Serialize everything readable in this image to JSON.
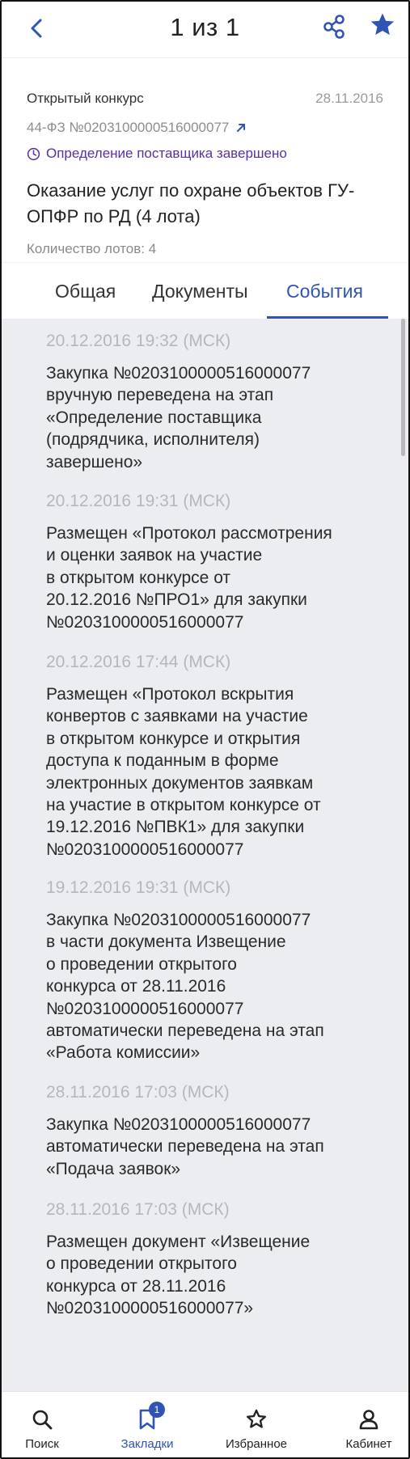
{
  "topbar": {
    "title": "1 из 1"
  },
  "procurement": {
    "type": "Открытый конкурс",
    "date": "28.11.2016",
    "number": "44-ФЗ №0203100000516000077",
    "status": "Определение поставщика завершено",
    "title": "Оказание услуг по охране объектов ГУ-ОПФР по РД (4 лота)",
    "lots": "Количество лотов: 4"
  },
  "tabs": [
    {
      "label": "Общая"
    },
    {
      "label": "Документы"
    },
    {
      "label": "События"
    }
  ],
  "events": [
    {
      "date": "20.12.2016 19:32 (МСК)",
      "text": "Закупка №0203100000516000077\nвручную переведена на этап\n«Определение поставщика\n(подрядчика, исполнителя)\nзавершено»"
    },
    {
      "date": "20.12.2016 19:31 (МСК)",
      "text": "Размещен «Протокол рассмотрения\nи оценки заявок на участие\nв открытом конкурсе от\n20.12.2016 №ПРО1» для закупки\n№0203100000516000077"
    },
    {
      "date": "20.12.2016 17:44 (МСК)",
      "text": "Размещен «Протокол вскрытия\nконвертов с заявками на участие\nв открытом конкурсе и открытия\nдоступа к поданным в форме\nэлектронных документов заявкам\nна участие в открытом конкурсе от\n19.12.2016 №ПВК1» для закупки\n№0203100000516000077"
    },
    {
      "date": "19.12.2016 19:31 (МСК)",
      "text": "Закупка №0203100000516000077\nв части документа Извещение\nо проведении открытого\nконкурса от 28.11.2016\n№0203100000516000077\nавтоматически переведена на этап\n«Работа комиссии»"
    },
    {
      "date": "28.11.2016 17:03 (МСК)",
      "text": "Закупка №0203100000516000077\nавтоматически переведена на этап\n«Подача заявок»"
    },
    {
      "date": "28.11.2016 17:03 (МСК)",
      "text": "Размещен документ «Извещение\nо проведении открытого\nконкурса от 28.11.2016\n№0203100000516000077»"
    }
  ],
  "bottomnav": {
    "search": "Поиск",
    "bookmarks": "Закладки",
    "bookmarks_badge": "1",
    "favorites": "Избранное",
    "cabinet": "Кабинет"
  },
  "colors": {
    "accent": "#2f54b5",
    "status": "#5a2fa0",
    "events_bg": "#ecedf0"
  },
  "icons": {
    "back": "chevron-left-icon",
    "share": "share-icon",
    "favorite": "star-icon",
    "external": "external-link-icon",
    "status": "clock-icon",
    "search": "search-icon",
    "bookmarks": "bookmark-icon",
    "favorites": "star-outline-icon",
    "cabinet": "user-icon"
  }
}
